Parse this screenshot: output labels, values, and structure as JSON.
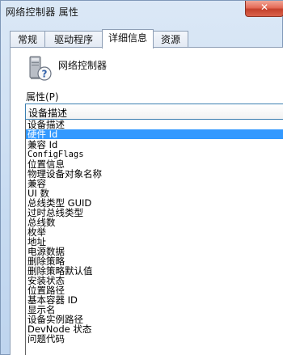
{
  "window": {
    "title": "网络控制器 属性",
    "close_glyph": "✕"
  },
  "tabs": [
    {
      "label": "常规"
    },
    {
      "label": "驱动程序"
    },
    {
      "label": "详细信息"
    },
    {
      "label": "资源"
    }
  ],
  "active_tab": "详细信息",
  "device": {
    "icon": "unknown-device-icon",
    "name": "网络控制器"
  },
  "property": {
    "label": "属性(P)",
    "selected_value": "设备描述",
    "options": [
      "设备描述",
      "硬件 Id",
      "兼容 Id",
      "ConfigFlags",
      "位置信息",
      "物理设备对象名称",
      "兼容",
      "UI 数",
      "总线类型 GUID",
      "过时总线类型",
      "总线数",
      "枚举",
      "地址",
      "电源数据",
      "删除策略",
      "删除策略默认值",
      "安装状态",
      "位置路径",
      "基本容器 ID",
      "显示名",
      "设备实例路径",
      "DevNode 状态",
      "问题代码"
    ],
    "highlighted_index": 1
  },
  "colors": {
    "highlight": "#3399ff",
    "close_button": "#d9614b"
  }
}
